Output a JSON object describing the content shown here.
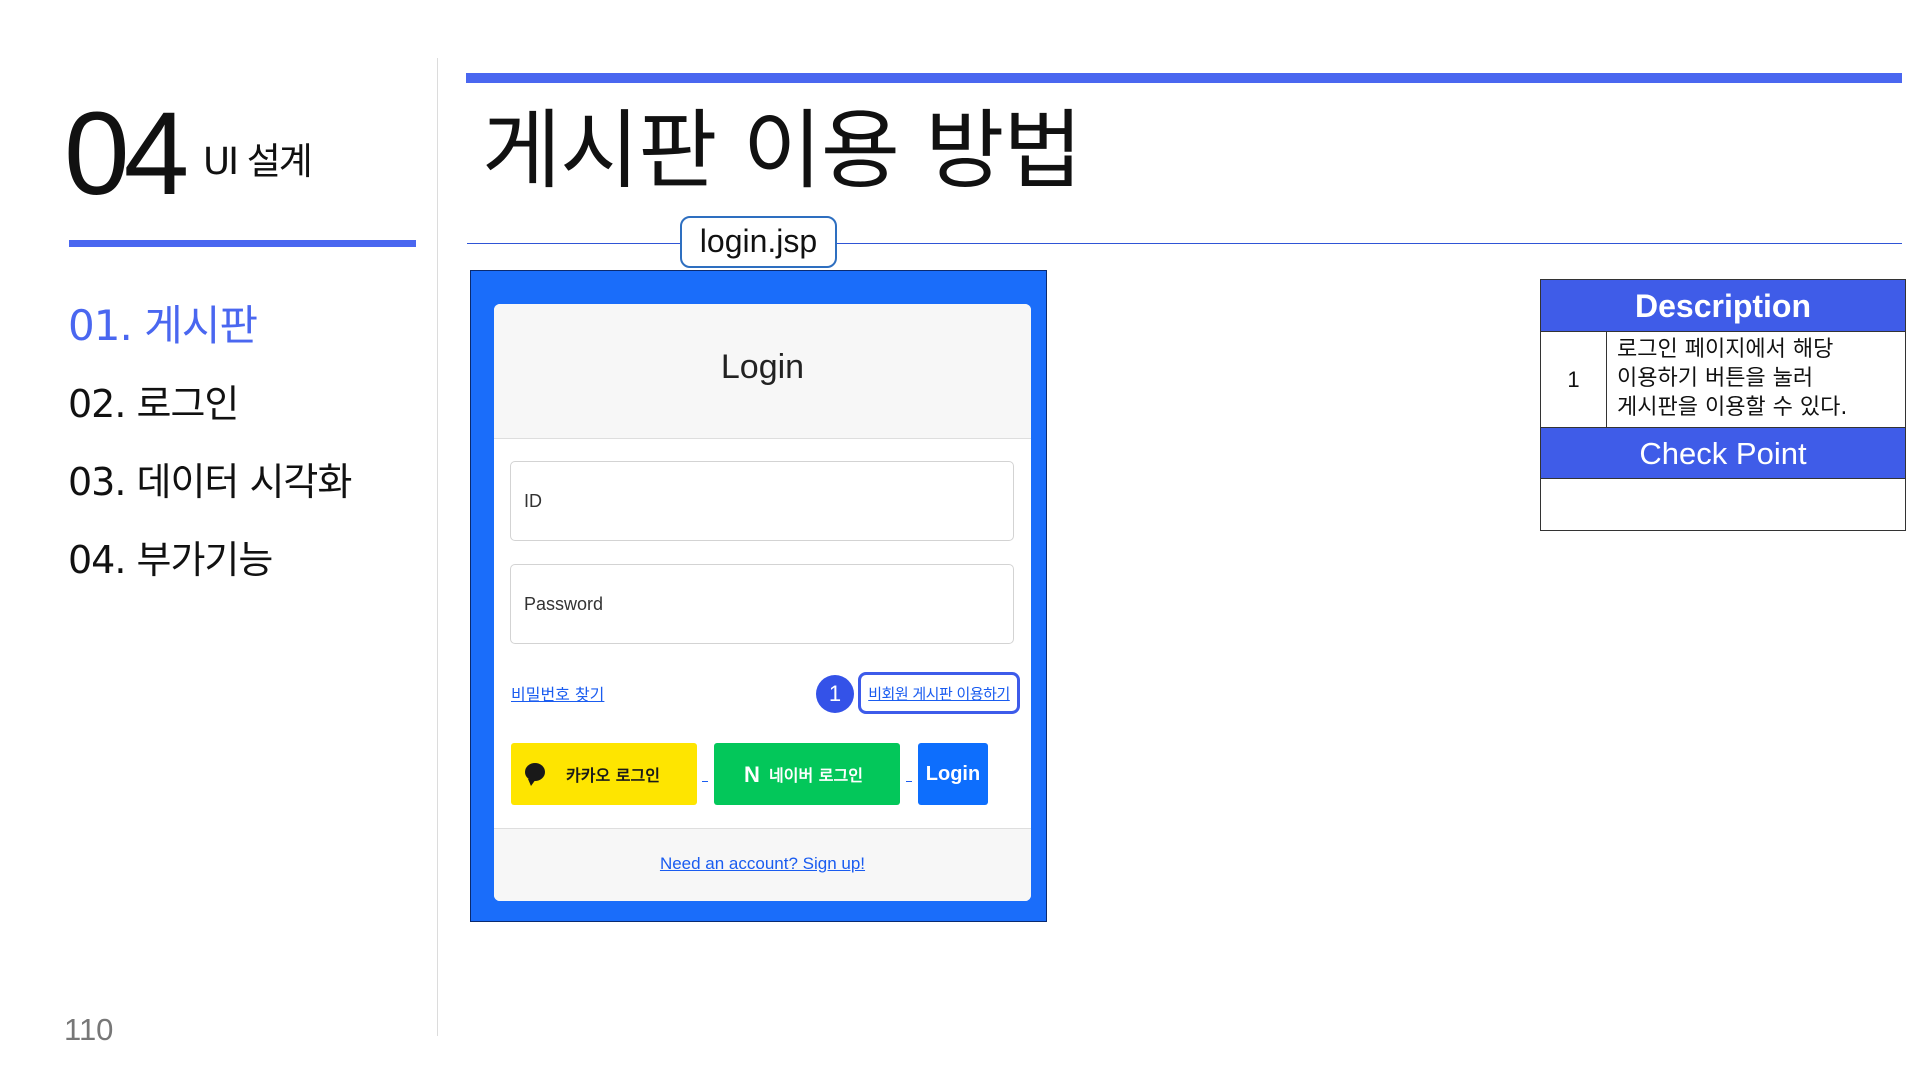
{
  "sidebar": {
    "section_number": "04",
    "section_name": "UI 설계",
    "nav": [
      {
        "label": "01. 게시판",
        "active": true
      },
      {
        "label": "02. 로그인",
        "active": false
      },
      {
        "label": "03. 데이터 시각화",
        "active": false
      },
      {
        "label": "04. 부가기능",
        "active": false
      }
    ],
    "page_number": "110"
  },
  "header": {
    "title": "게시판 이용 방법",
    "file_tag": "login.jsp"
  },
  "login_screen": {
    "title": "Login",
    "id_placeholder": "ID",
    "password_placeholder": "Password",
    "forgot_password_link": "비밀번호 찾기",
    "guest_board_link": "비회원 게시판 이용하기",
    "marker": "1",
    "kakao_button": "카카오 로그인",
    "naver_button": "네이버 로그인",
    "naver_logo": "N",
    "login_button": "Login",
    "signup_link": "Need an account? Sign up!",
    "colors": {
      "frame": "#1a6dfa",
      "kakao": "#fee500",
      "naver": "#03c75a",
      "login": "#0d6efd"
    }
  },
  "description_table": {
    "header": "Description",
    "rows": [
      {
        "num": "1",
        "text": "로그인 페이지에서 해당 이용하기 버튼을 눌러 게시판을 이용할 수 있다."
      }
    ],
    "checkpoint_header": "Check Point",
    "checkpoint_text": ""
  },
  "theme": {
    "accent": "#4a67f0"
  }
}
